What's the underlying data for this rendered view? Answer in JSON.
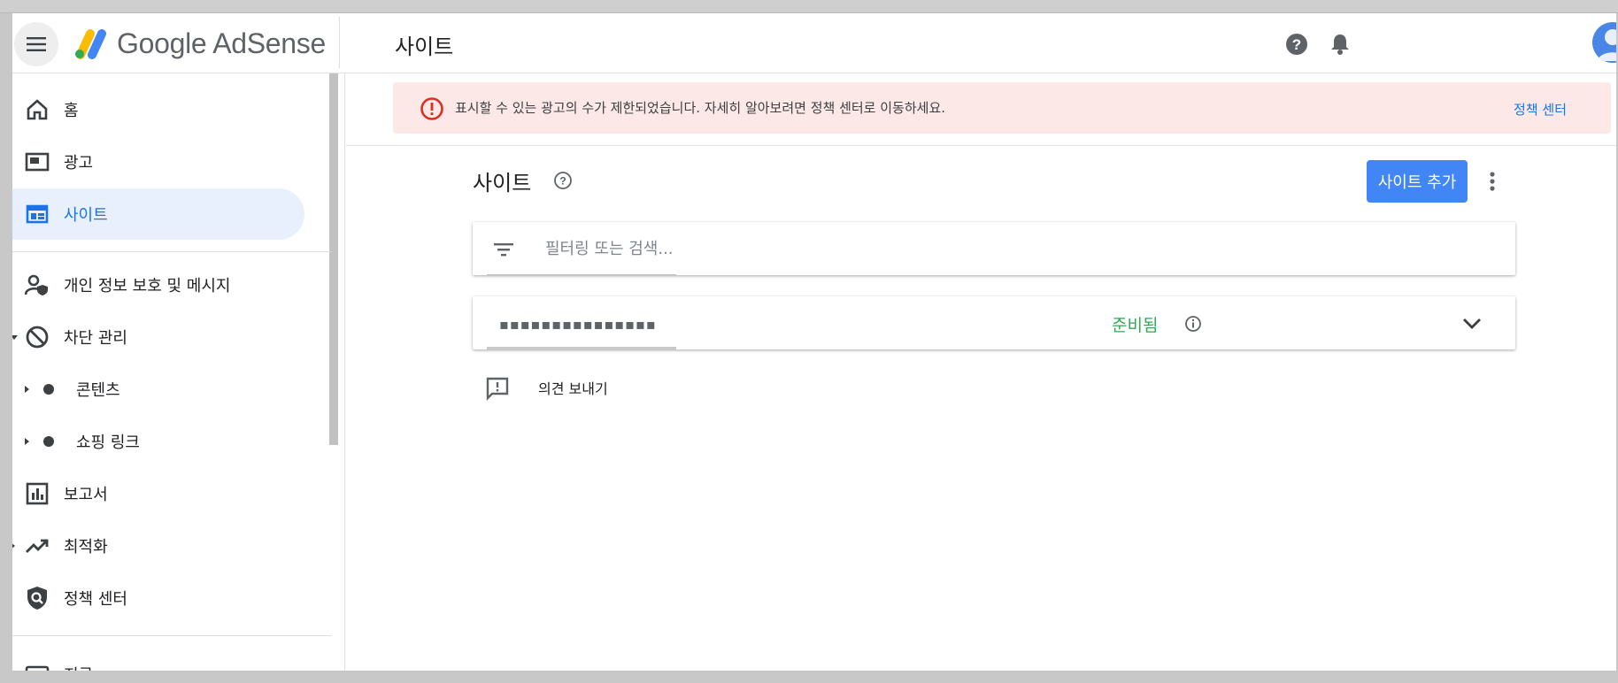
{
  "header": {
    "app_name": "Google AdSense",
    "page_title": "사이트"
  },
  "sidebar": {
    "items": [
      {
        "label": "홈",
        "icon": "home-icon"
      },
      {
        "label": "광고",
        "icon": "ads-icon"
      },
      {
        "label": "사이트",
        "icon": "sites-icon",
        "active": true
      },
      {
        "label": "개인 정보 보호 및 메시지",
        "icon": "privacy-icon"
      },
      {
        "label": "차단 관리",
        "icon": "block-icon"
      },
      {
        "label": "콘텐츠",
        "icon": "dot-icon"
      },
      {
        "label": "쇼핑 링크",
        "icon": "dot-icon"
      },
      {
        "label": "보고서",
        "icon": "reports-icon"
      },
      {
        "label": "최적화",
        "icon": "optimization-icon"
      },
      {
        "label": "정책 센터",
        "icon": "policy-icon"
      },
      {
        "label": "지급",
        "icon": "payments-icon"
      }
    ]
  },
  "banner": {
    "message": "표시할 수 있는 광고의 수가 제한되었습니다. 자세히 알아보려면 정책 센터로 이동하세요.",
    "link_label": "정책 센터",
    "color": "#fce8e6",
    "icon_color": "#d93025"
  },
  "main": {
    "section_title": "사이트",
    "add_button_label": "사이트 추가",
    "search_placeholder": "필터링 또는 검색...",
    "sites": [
      {
        "name": "▪▪▪▪▪▪▪▪▪▪▪▪▪▪▪",
        "status": "준비됨"
      }
    ],
    "feedback_label": "의견 보내기"
  },
  "colors": {
    "accent": "#1a73e8",
    "button": "#4285f4",
    "status_ready": "#34a853"
  }
}
